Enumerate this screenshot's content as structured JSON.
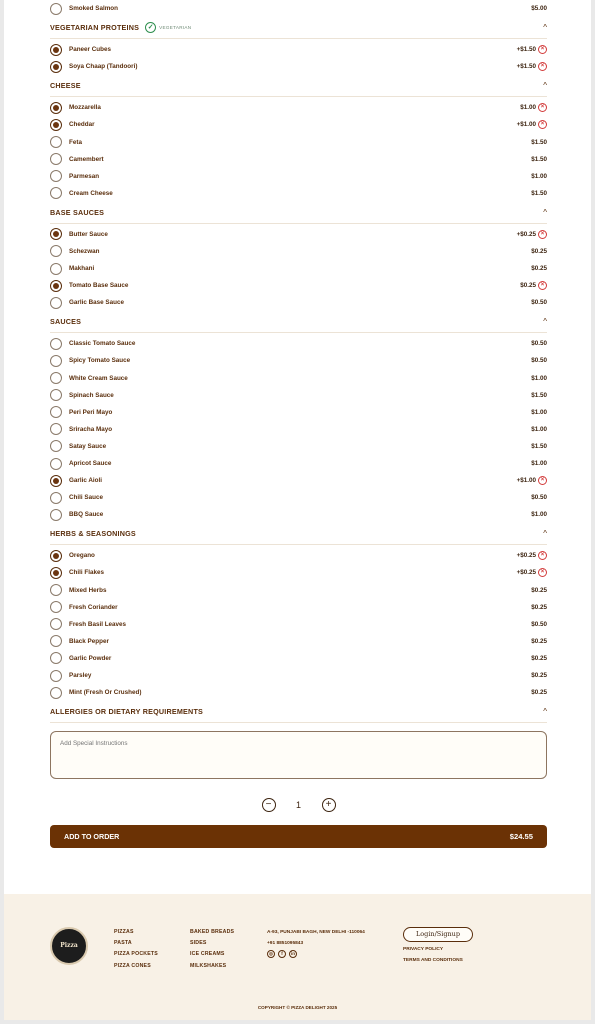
{
  "sections": [
    {
      "title": "",
      "options": [
        {
          "name": "Smoked Salmon",
          "price": "$5.00",
          "selected": false
        }
      ]
    },
    {
      "title": "VEGETARIAN PROTEINS",
      "badge": "VEGETARIAN",
      "options": [
        {
          "name": "Paneer Cubes",
          "price": "+$1.50",
          "selected": true
        },
        {
          "name": "Soya Chaap (Tandoori)",
          "price": "+$1.50",
          "selected": true
        }
      ]
    },
    {
      "title": "CHEESE",
      "options": [
        {
          "name": "Mozzarella",
          "price": "$1.00",
          "selected": true
        },
        {
          "name": "Cheddar",
          "price": "+$1.00",
          "selected": true
        },
        {
          "name": "Feta",
          "price": "$1.50",
          "selected": false
        },
        {
          "name": "Camembert",
          "price": "$1.50",
          "selected": false
        },
        {
          "name": "Parmesan",
          "price": "$1.00",
          "selected": false
        },
        {
          "name": "Cream Cheese",
          "price": "$1.50",
          "selected": false
        }
      ]
    },
    {
      "title": "BASE SAUCES",
      "options": [
        {
          "name": "Butter Sauce",
          "price": "+$0.25",
          "selected": true
        },
        {
          "name": "Schezwan",
          "price": "$0.25",
          "selected": false
        },
        {
          "name": "Makhani",
          "price": "$0.25",
          "selected": false
        },
        {
          "name": "Tomato Base Sauce",
          "price": "$0.25",
          "selected": true
        },
        {
          "name": "Garlic Base Sauce",
          "price": "$0.50",
          "selected": false
        }
      ]
    },
    {
      "title": "SAUCES",
      "options": [
        {
          "name": "Classic Tomato Sauce",
          "price": "$0.50",
          "selected": false
        },
        {
          "name": "Spicy Tomato Sauce",
          "price": "$0.50",
          "selected": false
        },
        {
          "name": "White Cream Sauce",
          "price": "$1.00",
          "selected": false
        },
        {
          "name": "Spinach Sauce",
          "price": "$1.50",
          "selected": false
        },
        {
          "name": "Peri Peri Mayo",
          "price": "$1.00",
          "selected": false
        },
        {
          "name": "Sriracha Mayo",
          "price": "$1.00",
          "selected": false
        },
        {
          "name": "Satay Sauce",
          "price": "$1.50",
          "selected": false
        },
        {
          "name": "Apricot Sauce",
          "price": "$1.00",
          "selected": false
        },
        {
          "name": "Garlic Aioli",
          "price": "+$1.00",
          "selected": true
        },
        {
          "name": "Chili Sauce",
          "price": "$0.50",
          "selected": false
        },
        {
          "name": "BBQ Sauce",
          "price": "$1.00",
          "selected": false
        }
      ]
    },
    {
      "title": "HERBS & SEASONINGS",
      "options": [
        {
          "name": "Oregano",
          "price": "+$0.25",
          "selected": true
        },
        {
          "name": "Chili Flakes",
          "price": "+$0.25",
          "selected": true
        },
        {
          "name": "Mixed Herbs",
          "price": "$0.25",
          "selected": false
        },
        {
          "name": "Fresh Coriander",
          "price": "$0.25",
          "selected": false
        },
        {
          "name": "Fresh Basil Leaves",
          "price": "$0.50",
          "selected": false
        },
        {
          "name": "Black Pepper",
          "price": "$0.25",
          "selected": false
        },
        {
          "name": "Garlic Powder",
          "price": "$0.25",
          "selected": false
        },
        {
          "name": "Parsley",
          "price": "$0.25",
          "selected": false
        },
        {
          "name": "Mint (Fresh Or Crushed)",
          "price": "$0.25",
          "selected": false
        }
      ]
    }
  ],
  "allergies": {
    "title": "ALLERGIES OR DIETARY REQUIREMENTS",
    "placeholder": "Add Special Instructions"
  },
  "quantity": {
    "value": "1",
    "minus": "−",
    "plus": "+"
  },
  "add_to_order": {
    "label": "ADD TO ORDER",
    "total": "$24.55"
  },
  "icons": {
    "chevron": "^",
    "remove": "×",
    "check": "✓"
  },
  "footer": {
    "logo_text": "Pizza",
    "col1": [
      "PIZZAS",
      "PASTA",
      "PIZZA POCKETS",
      "PIZZA CONES"
    ],
    "col2": [
      "BAKED BREADS",
      "SIDES",
      "ICE CREAMS",
      "MILKSHAKES"
    ],
    "address": "A-93, PUNJABI BAGH, NEW DELHI -110064",
    "phone": "+91 8851095843",
    "socials": [
      "◎",
      "f",
      "in"
    ],
    "login_label": "Login/Signup",
    "privacy": "PRIVACY POLICY",
    "terms": "TERMS AND CONDITIONS",
    "copyright": "COPYRIGHT © PIZZA DELIGHT 2025"
  },
  "colors": {
    "accent": "#6b3205",
    "remove": "#d23b3b",
    "veg": "#2f8f4f",
    "footer_bg": "#f8f1e6"
  }
}
